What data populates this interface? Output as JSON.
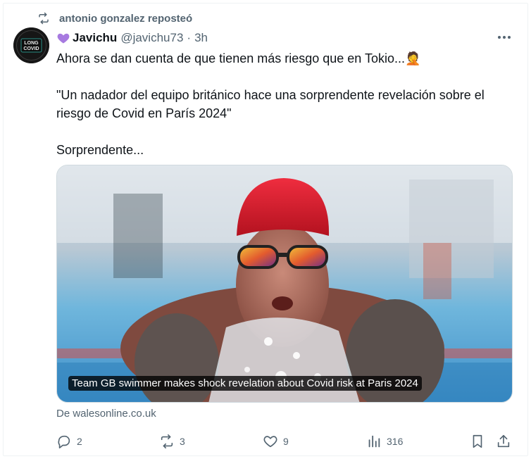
{
  "repost": {
    "text": "antonio gonzalez reposteó"
  },
  "avatar": {
    "alt_text_top": "LONG COVID",
    "line1": "LONG",
    "line2": "COVID"
  },
  "author": {
    "name": "Javichu",
    "handle": "@javichu73",
    "separator": "·",
    "time": "3h"
  },
  "tweet": {
    "lines": [
      "Ahora se dan cuenta de que tienen más riesgo que en Tokio...🤦",
      "",
      "\"Un nadador del equipo británico hace una sorprendente revelación sobre el",
      "riesgo de Covid en París 2024\"",
      "",
      "Sorprendente..."
    ]
  },
  "card": {
    "caption": "Team GB swimmer makes shock revelation about Covid risk at Paris 2024",
    "source": "De walesonline.co.uk"
  },
  "actions": {
    "replies": "2",
    "reposts": "3",
    "likes": "9",
    "views": "316"
  },
  "colors": {
    "text": "#0f1419",
    "muted": "#536471",
    "border": "#cfd9de",
    "heart": "#a77ae0"
  }
}
